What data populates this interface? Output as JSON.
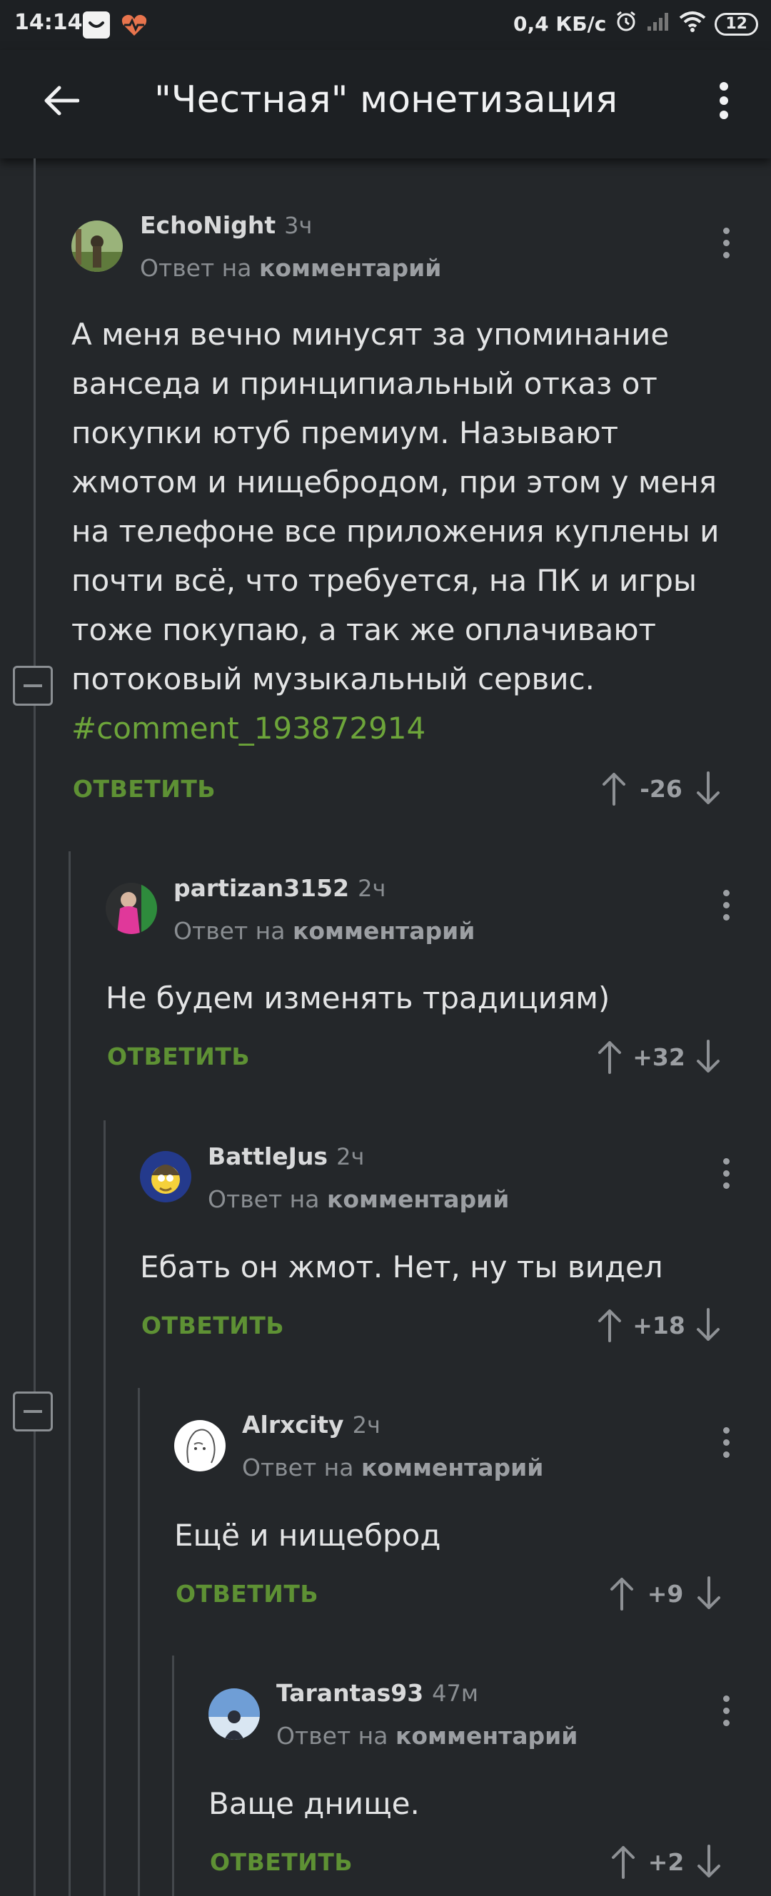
{
  "status_bar": {
    "time": "14:14",
    "net_speed": "0,4 КБ/с",
    "battery": "12"
  },
  "header": {
    "title": "\"Честная\" монетизация"
  },
  "colors": {
    "background": "#24272a",
    "accent_green": "#5e9134",
    "hashtag_green": "#6da53a",
    "muted": "#8a8e92"
  },
  "comments": [
    {
      "author": "EchoNight",
      "time": "3ч",
      "reply_prefix": "Ответ на",
      "reply_target": "комментарий",
      "text": "А меня вечно минусят за упоминание ванседа и принципиальный отказ от покупки ютуб премиум. Называют жмотом и нищебродом, при этом у меня на телефоне все приложения куплены и почти всё, что требуется, на ПК и игры тоже покупаю, а так же оплачивают потоковый музыкальный сервис.",
      "hashtag": "#comment_193872914",
      "reply_label": "ОТВЕТИТЬ",
      "score": "-26"
    },
    {
      "author": "partizan3152",
      "time": "2ч",
      "reply_prefix": "Ответ на",
      "reply_target": "комментарий",
      "text": "Не будем изменять традициям)",
      "reply_label": "ОТВЕТИТЬ",
      "score": "+32"
    },
    {
      "author": "BattleJus",
      "time": "2ч",
      "reply_prefix": "Ответ на",
      "reply_target": "комментарий",
      "text": "Ебать он жмот. Нет, ну ты видел",
      "reply_label": "ОТВЕТИТЬ",
      "score": "+18"
    },
    {
      "author": "Alrxcity",
      "time": "2ч",
      "reply_prefix": "Ответ на",
      "reply_target": "комментарий",
      "text": "Ещё и нищеброд",
      "reply_label": "ОТВЕТИТЬ",
      "score": "+9"
    },
    {
      "author": "Tarantas93",
      "time": "47м",
      "reply_prefix": "Ответ на",
      "reply_target": "комментарий",
      "text": "Ваще днище.",
      "reply_label": "ОТВЕТИТЬ",
      "score": "+2"
    }
  ]
}
